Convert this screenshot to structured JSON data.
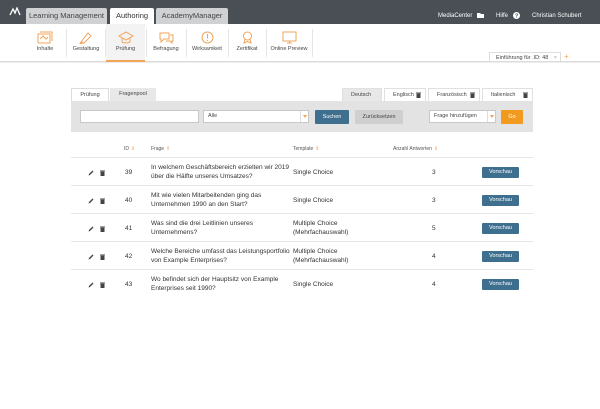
{
  "topbar": {
    "tabs": [
      {
        "label": "Learning Management",
        "active": false
      },
      {
        "label": "Authoring",
        "active": true
      },
      {
        "label": "AcademyManager",
        "active": false
      }
    ],
    "mediacenter": "MediaCenter",
    "help": "Hilfe",
    "user": "Christian Schubert"
  },
  "toolbar": {
    "items": [
      {
        "label": "Inhalte",
        "icon": "content-icon"
      },
      {
        "label": "Gestaltung",
        "icon": "design-icon"
      },
      {
        "label": "Prüfung",
        "icon": "exam-icon",
        "active": true
      },
      {
        "label": "Befragung",
        "icon": "survey-icon"
      },
      {
        "label": "Wirksamkeit",
        "icon": "effectiveness-icon"
      },
      {
        "label": "Zertifikat",
        "icon": "certificate-icon"
      },
      {
        "label": "Online Preview",
        "icon": "preview-icon"
      }
    ]
  },
  "breadcrumb": {
    "label": "Einführung für .ID: 48",
    "close": "×",
    "plus": "+"
  },
  "subtabs": [
    "Prüfung",
    "Fragenpool"
  ],
  "languages": [
    "Deutsch",
    "Englisch",
    "Französisch",
    "Italienisch"
  ],
  "search": {
    "input_value": "",
    "filter_value": "Alle",
    "search_label": "Suchen",
    "reset_label": "Zurücksetzen",
    "add_value": "Frage hinzufügen",
    "go_label": "Go"
  },
  "table": {
    "headers": {
      "id": "ID",
      "question": "Frage",
      "template": "Template",
      "answers": "Anzahl Antworten"
    },
    "preview_label": "Vorschau",
    "rows": [
      {
        "id": "39",
        "q1": "In welchem Geschäftsbereich erzielten wir 2019",
        "q2": "über die Hälfte unseres Umsatzes?",
        "t1": "Single Choice",
        "t2": "",
        "n": "3"
      },
      {
        "id": "40",
        "q1": "Mit wie vielen Mitarbeitenden ging das",
        "q2": "Unternehmen 1990 an den Start?",
        "t1": "Single Choice",
        "t2": "",
        "n": "3"
      },
      {
        "id": "41",
        "q1": "Was sind die drei Leitlinien unseres",
        "q2": "Unternehmens?",
        "t1": "Multiple Choice",
        "t2": "(Mehrfachauswahl)",
        "n": "5"
      },
      {
        "id": "42",
        "q1": "Welche Bereiche umfasst das Leistungsportfolio",
        "q2": "von Example Enterprises?",
        "t1": "Multiple Choice",
        "t2": "(Mehrfachauswahl)",
        "n": "4"
      },
      {
        "id": "43",
        "q1": "Wo befindet sich der Hauptsitz von Example",
        "q2": "Enterprises seit 1990?",
        "t1": "Single Choice",
        "t2": "",
        "n": "4"
      }
    ]
  },
  "colors": {
    "accent": "#f0a45a",
    "primary_button": "#3f6f8f",
    "topbar": "#4a4f55",
    "go_button": "#f29a1f"
  }
}
